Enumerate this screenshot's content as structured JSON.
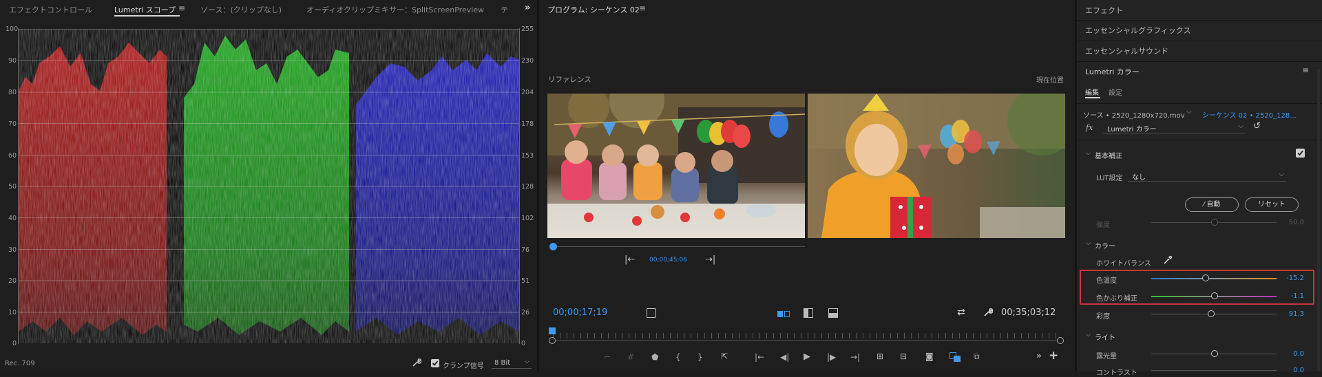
{
  "scope_panel": {
    "tabs": [
      "エフェクトコントロール",
      "Lumetri スコープ",
      "ソース：(クリップなし)",
      "オーディオクリップミキサー：SplitScreenPreview",
      "テ"
    ],
    "left_ticks": [
      "100",
      "90",
      "80",
      "70",
      "60",
      "50",
      "40",
      "30",
      "20",
      "10",
      "0"
    ],
    "right_ticks": [
      "255",
      "230",
      "204",
      "178",
      "153",
      "128",
      "102",
      "76",
      "51",
      "26",
      "0"
    ],
    "footer_label": "Rec. 709",
    "clamp_label": "クランプ信号",
    "bit_depth": "8 Bit"
  },
  "program_panel": {
    "title": "プログラム: シーケンス 02",
    "reference_label": "リファレンス",
    "current_label": "現在位置",
    "ref_timecode": "00;00;45;06",
    "timecode": "00;00;17;19",
    "duration": "00;35;03;12"
  },
  "right_panel": {
    "sections": [
      "エフェクト",
      "エッセンシャルグラフィックス",
      "エッセンシャルサウンド"
    ],
    "lumetri_title": "Lumetri カラー",
    "tabs": [
      "編集",
      "設定"
    ],
    "source_label": "ソース • 2520_1280x720.mov",
    "sequence_label": "シーケンス 02 • 2520_128...",
    "fx_label": "fx",
    "effect_select": "Lumetri カラー",
    "basic_section": "基本補正",
    "lut_label": "LUT設定",
    "lut_value": "なし",
    "auto_button": "自動",
    "reset_button": "リセット",
    "strength_label": "強度",
    "strength_value": "50.0",
    "color_section": "カラー",
    "white_balance_label": "ホワイトバランス",
    "temp_label": "色温度",
    "temp_value": "-15.2",
    "tint_label": "色かぶり補正",
    "tint_value": "-1.1",
    "sat_label": "彩度",
    "sat_value": "91.3",
    "light_section": "ライト",
    "exposure_label": "露光量",
    "exposure_value": "0.0",
    "contrast_label": "コントラスト",
    "contrast_value": "0.0"
  },
  "colors": {
    "accent": "#3a9af4",
    "highlight_box": "#c8343f"
  }
}
